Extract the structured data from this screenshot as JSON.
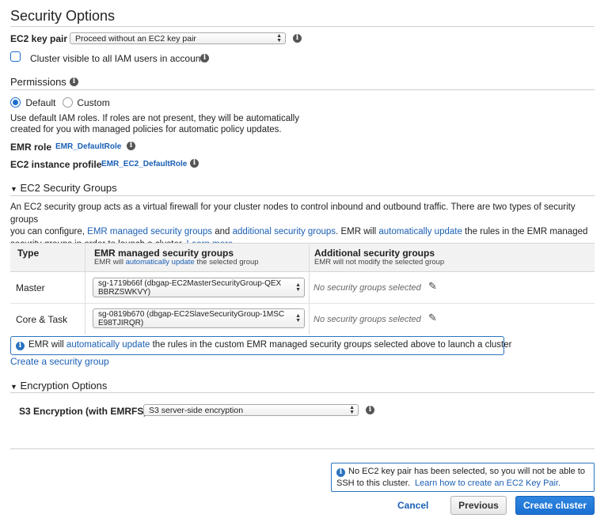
{
  "security": {
    "title": "Security Options",
    "ec2_key_pair_label": "EC2 key pair",
    "ec2_key_pair_value": "Proceed without an EC2 key pair",
    "cluster_visible_label": "Cluster visible to all IAM users in account"
  },
  "permissions": {
    "title": "Permissions",
    "default_label": "Default",
    "custom_label": "Custom",
    "description_line1": "Use default IAM roles. If roles are not present, they will be automatically",
    "description_line2": "created for you with managed policies for automatic policy updates.",
    "emr_role_label": "EMR role",
    "emr_role_value": "EMR_DefaultRole",
    "instance_profile_label": "EC2 instance profile",
    "instance_profile_value": "EMR_EC2_DefaultRole"
  },
  "sg": {
    "title": "EC2 Security Groups",
    "desc_1": "An EC2 security group acts as a virtual firewall for your cluster nodes to control inbound and outbound traffic. There are two types of security groups",
    "desc_2a": "you can configure, ",
    "desc_link_emr": "EMR managed security groups",
    "desc_2b": " and ",
    "desc_link_additional": "additional security groups",
    "desc_2c": ". EMR will ",
    "desc_link_auto": "automatically update",
    "desc_2d": " the rules in the EMR managed",
    "desc_3a": "security groups in order to launch a cluster. ",
    "desc_link_learn": "Learn more.",
    "col_type": "Type",
    "col_emr": "EMR managed security groups",
    "col_emr_sub_a": "EMR will ",
    "col_emr_sub_link": "automatically update",
    "col_emr_sub_b": " the selected group",
    "col_additional": "Additional security groups",
    "col_additional_sub": "EMR will not modify the selected group",
    "rows": [
      {
        "type": "Master",
        "sg_line1": "sg-1719b66f (dbgap-EC2MasterSecurityGroup-QEX",
        "sg_line2": "BBRZSWKVY)",
        "additional": "No security groups selected"
      },
      {
        "type": "Core & Task",
        "sg_line1": "sg-0819b670 (dbgap-EC2SlaveSecurityGroup-1MSC",
        "sg_line2": "E98TJIRQR)",
        "additional": "No security groups selected"
      }
    ],
    "info_a": "EMR will ",
    "info_link": "automatically update",
    "info_b": " the rules in the custom EMR managed security groups selected above to launch a cluster",
    "create_link": "Create a security group"
  },
  "encryption": {
    "title": "Encryption Options",
    "s3_label": "S3 Encryption (with EMRFS)",
    "s3_value": "S3 server-side encryption"
  },
  "footer": {
    "notice_line1": "No EC2 key pair has been selected, so you will not be able to",
    "notice_line2a": "SSH to this cluster.  ",
    "notice_link": "Learn how to create an EC2 Key Pair.",
    "cancel": "Cancel",
    "previous": "Previous",
    "create": "Create cluster"
  },
  "colors": {
    "link": "#1a5fb4",
    "primary": "#1a6fd1",
    "info_border": "#2b73c0"
  }
}
